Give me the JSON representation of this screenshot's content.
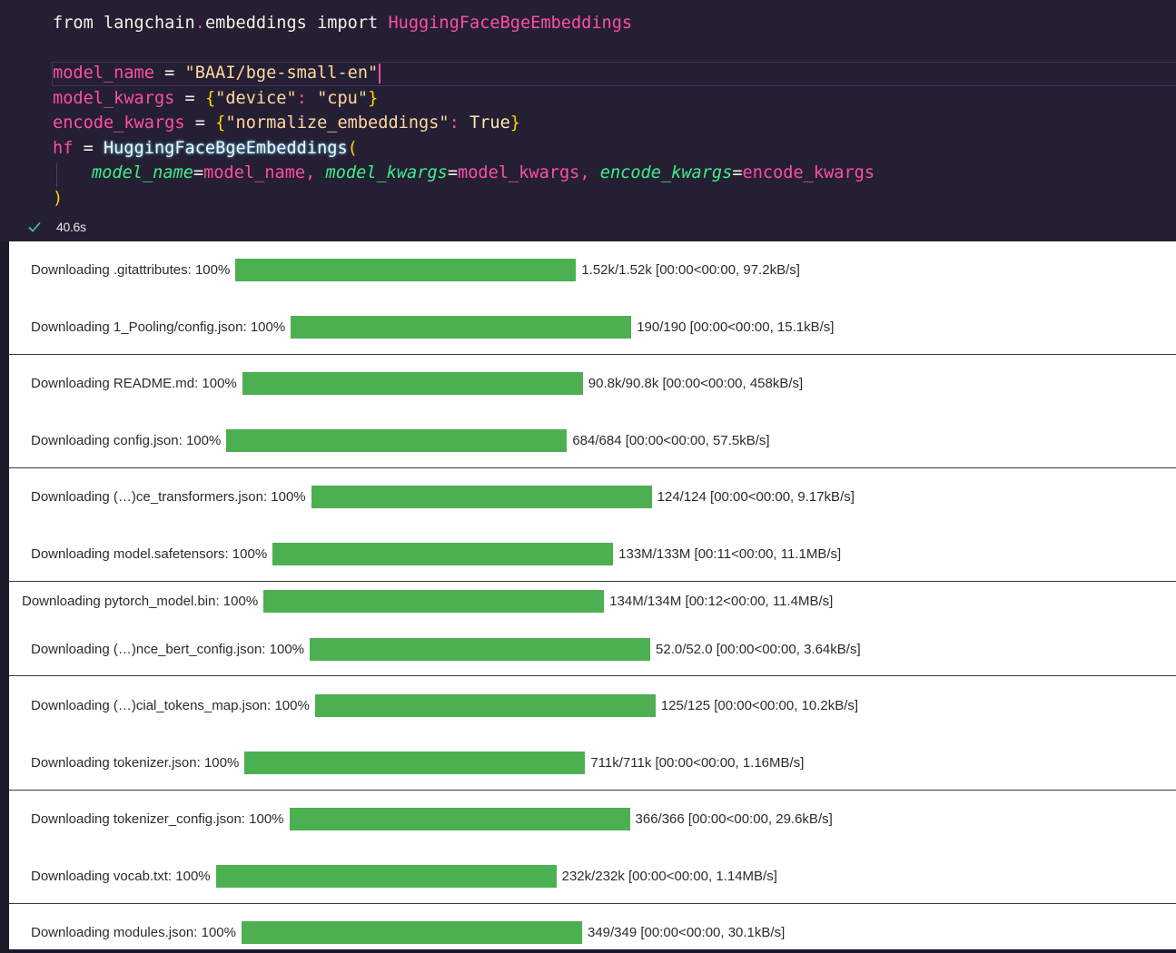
{
  "code": {
    "line1": {
      "kw_from": "from",
      "module_a": " langchain",
      "dot": ".",
      "module_b": "embeddings",
      "kw_import": " import ",
      "class_name": "HuggingFaceBgeEmbeddings"
    },
    "line2": {
      "var": "model_name",
      "op": " = ",
      "str": "\"BAAI/bge-small-en\""
    },
    "line3": {
      "var": "model_kwargs",
      "op": " = ",
      "lbrace": "{",
      "key": "\"device\"",
      "colon": ": ",
      "val": "\"cpu\"",
      "rbrace": "}"
    },
    "line4": {
      "var": "encode_kwargs",
      "op": " = ",
      "lbrace": "{",
      "key": "\"normalize_embeddings\"",
      "colon": ": ",
      "val": "True",
      "rbrace": "}"
    },
    "line5": {
      "var": "hf",
      "op": " = ",
      "call": "HuggingFaceBgeEmbeddings",
      "paren": "("
    },
    "line6": {
      "p1": "model_name",
      "eq1": "=",
      "a1": "model_name",
      "c1": ", ",
      "p2": "model_kwargs",
      "eq2": "=",
      "a2": "model_kwargs",
      "c2": ", ",
      "p3": "encode_kwargs",
      "eq3": "=",
      "a3": "encode_kwargs"
    },
    "line7": {
      "paren": ")"
    }
  },
  "status": {
    "icon": "check-icon",
    "exec_time": "40.6s",
    "success_color": "#3ecf8e"
  },
  "output": {
    "bar_color": "#4caf50",
    "rows": [
      {
        "label": "Downloading .gitattributes: 100%",
        "progress": 1.0,
        "stats": "1.52k/1.52k [00:00<00:00, 97.2kB/s]"
      },
      {
        "label": "Downloading 1_Pooling/config.json: 100%",
        "progress": 1.0,
        "stats": "190/190 [00:00<00:00, 15.1kB/s]"
      },
      {
        "label": "Downloading README.md: 100%",
        "progress": 1.0,
        "stats": "90.8k/90.8k [00:00<00:00, 458kB/s]"
      },
      {
        "label": "Downloading config.json: 100%",
        "progress": 1.0,
        "stats": "684/684 [00:00<00:00, 57.5kB/s]"
      },
      {
        "label": "Downloading (…)ce_transformers.json: 100%",
        "progress": 1.0,
        "stats": "124/124 [00:00<00:00, 9.17kB/s]"
      },
      {
        "label": "Downloading model.safetensors: 100%",
        "progress": 1.0,
        "stats": "133M/133M [00:11<00:00, 11.1MB/s]"
      },
      {
        "label": "Downloading pytorch_model.bin: 100%",
        "progress": 1.0,
        "stats": "134M/134M [00:12<00:00, 11.4MB/s]"
      },
      {
        "label": "Downloading (…)nce_bert_config.json: 100%",
        "progress": 1.0,
        "stats": "52.0/52.0 [00:00<00:00, 3.64kB/s]"
      },
      {
        "label": "Downloading (…)cial_tokens_map.json: 100%",
        "progress": 1.0,
        "stats": "125/125 [00:00<00:00, 10.2kB/s]"
      },
      {
        "label": "Downloading tokenizer.json: 100%",
        "progress": 1.0,
        "stats": "711k/711k [00:00<00:00, 1.16MB/s]"
      },
      {
        "label": "Downloading tokenizer_config.json: 100%",
        "progress": 1.0,
        "stats": "366/366 [00:00<00:00, 29.6kB/s]"
      },
      {
        "label": "Downloading vocab.txt: 100%",
        "progress": 1.0,
        "stats": "232k/232k [00:00<00:00, 1.14MB/s]"
      },
      {
        "label": "Downloading modules.json: 100%",
        "progress": 1.0,
        "stats": "349/349 [00:00<00:00, 30.1kB/s]"
      }
    ]
  }
}
